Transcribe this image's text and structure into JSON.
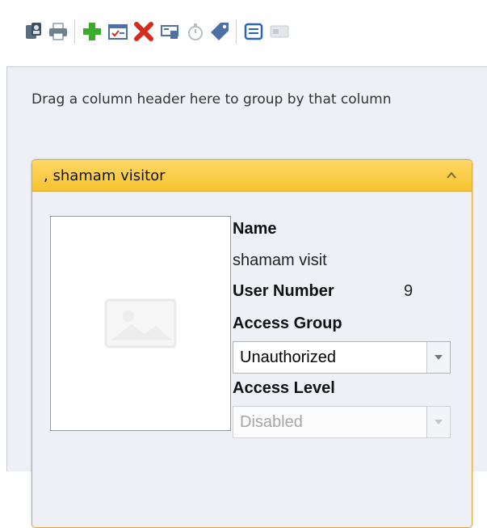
{
  "toolbar": {
    "icons": [
      "users-icon",
      "print-icon",
      "add-icon",
      "edit-card-icon",
      "delete-icon",
      "assign-icon",
      "timer-icon",
      "tag-icon",
      "list-view-icon",
      "card-view-icon"
    ]
  },
  "grid": {
    "group_hint": "Drag a column header here to group by that column"
  },
  "card": {
    "title": ", shamam visitor",
    "name_label": "Name",
    "name_value": "shamam visit",
    "user_number_label": "User Number",
    "user_number_value": "9",
    "access_group_label": "Access Group",
    "access_group_value": "Unauthorized",
    "access_level_label": "Access Level",
    "access_level_value": "Disabled"
  },
  "colors": {
    "header": "#f6c330",
    "border": "#d8a93a",
    "add": "#3cab2d",
    "delete": "#d52b1e",
    "accent": "#2b63c4"
  }
}
